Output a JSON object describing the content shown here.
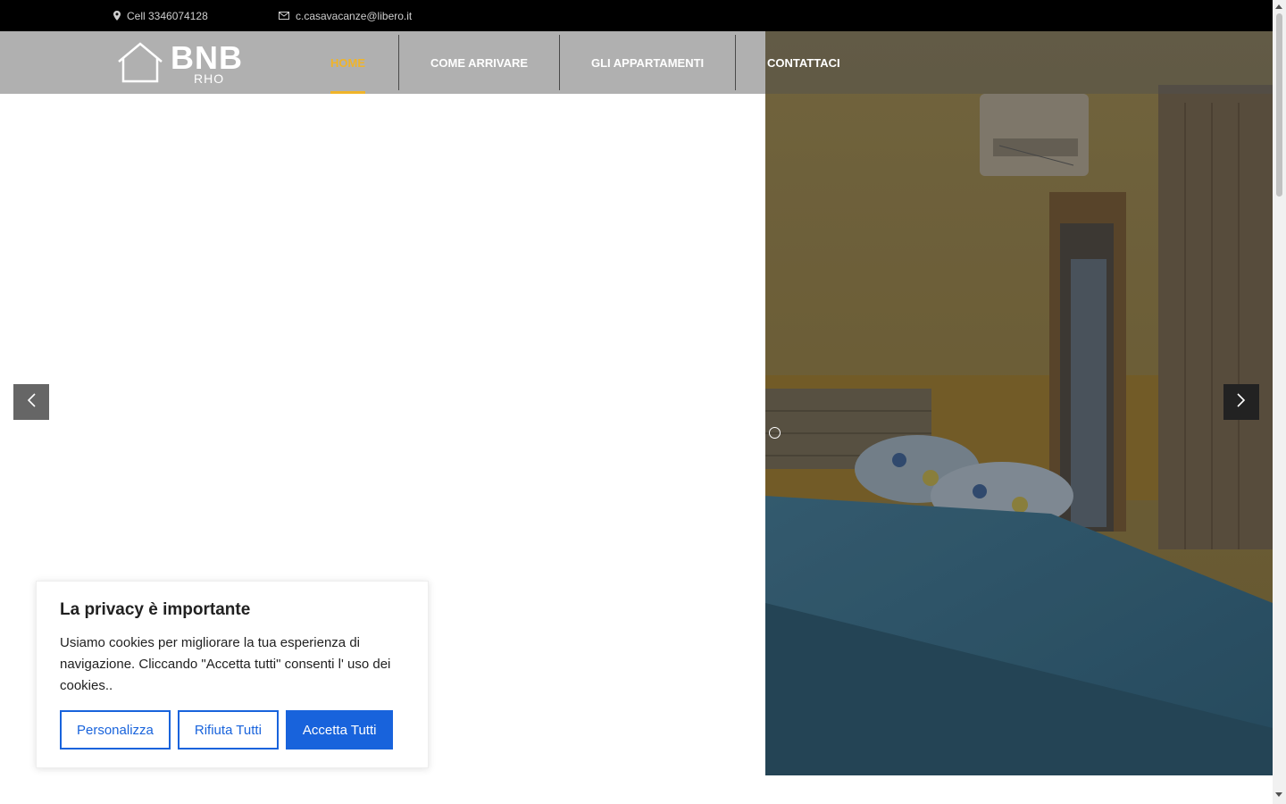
{
  "topbar": {
    "phone": "Cell 3346074128",
    "email": "c.casavacanze@libero.it",
    "phone_icon": "map-pin-icon",
    "email_icon": "envelope-icon"
  },
  "logo": {
    "title": "BNB",
    "subtitle": "RHO",
    "icon": "house-icon"
  },
  "nav": {
    "items": [
      {
        "label": "HOME",
        "active": true
      },
      {
        "label": "COME ARRIVARE",
        "active": false
      },
      {
        "label": "GLI APPARTAMENTI",
        "active": false
      },
      {
        "label": "CONTATTACI",
        "active": false
      }
    ]
  },
  "slider": {
    "prev_icon": "chevron-left-icon",
    "next_icon": "chevron-right-icon",
    "accent_color": "#f0b429"
  },
  "cookie": {
    "title": "La privacy è importante",
    "text": "Usiamo cookies per migliorare la tua esperienza di navigazione. Cliccando \"Accetta tutti\" consenti l' uso dei cookies..",
    "customize_label": "Personalizza",
    "reject_label": "Rifiuta Tutti",
    "accept_label": "Accetta Tutti",
    "brand_color": "#1863dc"
  }
}
